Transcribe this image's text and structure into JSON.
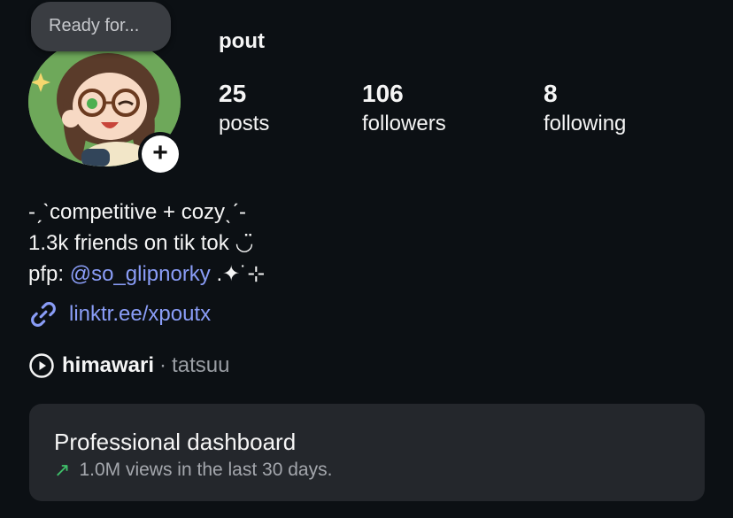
{
  "note": {
    "text": "Ready for..."
  },
  "profile": {
    "username": "pout",
    "stats": [
      {
        "value": "25",
        "label": "posts"
      },
      {
        "value": "106",
        "label": "followers"
      },
      {
        "value": "8",
        "label": "following"
      }
    ]
  },
  "bio": {
    "line1": "-ˏˋcompetitive + cozyˎˊ-",
    "line2": "1.3k friends on tik tok ◡̈",
    "line3_prefix": "pfp: ",
    "line3_mention": "@so_glipnorky",
    "line3_suffix": " .✦˙⊹"
  },
  "link": {
    "text": "linktr.ee/xpoutx"
  },
  "music": {
    "title": "himawari",
    "separator": "·",
    "artist": "tatsuu"
  },
  "dashboard": {
    "title": "Professional dashboard",
    "subtitle": "1.0M views in the last 30 days."
  },
  "colors": {
    "background": "#0c1014",
    "link": "#8a9df7",
    "trend": "#3fbf6a"
  }
}
